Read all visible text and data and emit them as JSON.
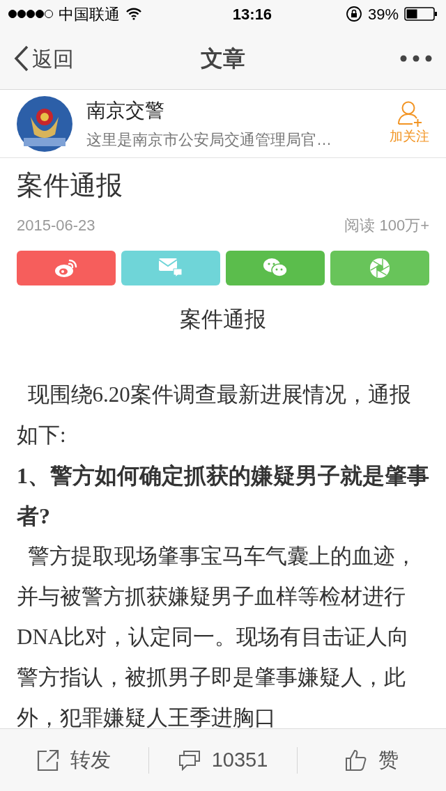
{
  "status_bar": {
    "carrier": "中国联通",
    "time": "13:16",
    "battery": "39%"
  },
  "nav_bar": {
    "back": "返回",
    "title": "文章"
  },
  "account": {
    "name": "南京交警",
    "description": "这里是南京市公安局交通管理局官…",
    "follow": "加关注"
  },
  "article": {
    "title": "案件通报",
    "date": "2015-06-23",
    "reads": "阅读 100万+",
    "share_buttons": [
      {
        "kind": "weibo",
        "color": "#f65e5c"
      },
      {
        "kind": "message",
        "color": "#6fd5d8"
      },
      {
        "kind": "wechat",
        "color": "#5bbd4c"
      },
      {
        "kind": "moments",
        "color": "#68c45a"
      }
    ],
    "body": [
      {
        "kind": "heading",
        "text": "案件通报"
      },
      {
        "kind": "paragraph",
        "text": "  现围绕6.20案件调查最新进展情况，通报如下:"
      },
      {
        "kind": "question",
        "text": "1、警方如何确定抓获的嫌疑男子就是肇事者?"
      },
      {
        "kind": "paragraph",
        "text": "  警方提取现场肇事宝马车气囊上的血迹，并与被警方抓获嫌疑男子血样等检材进行DNA比对，认定同一。现场有目击证人向警方指认，被抓男子即是肇事嫌疑人，此外，犯罪嫌疑人王季进胸口"
      }
    ]
  },
  "toolbar": {
    "forward": "转发",
    "comments": "10351",
    "like": "赞"
  }
}
